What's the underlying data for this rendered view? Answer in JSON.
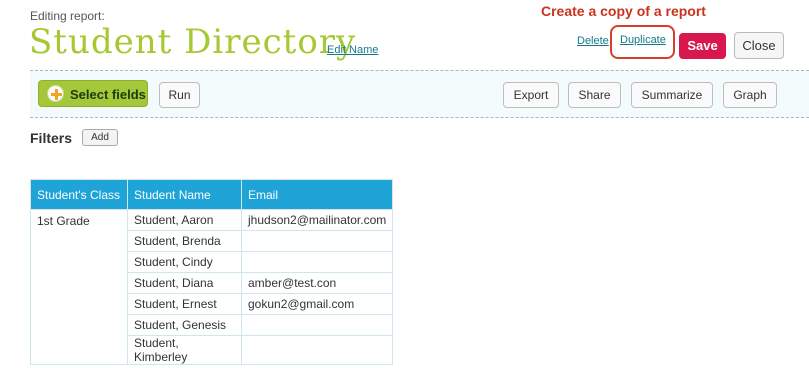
{
  "header": {
    "editing_label": "Editing report:",
    "title": "Student Directory",
    "edit_name": "Edit Name",
    "annotation": "Create a copy of a report",
    "delete_link": "Delete",
    "duplicate_link": "Duplicate",
    "save_button": "Save",
    "close_button": "Close"
  },
  "toolbar": {
    "select_fields": "Select fields",
    "run": "Run",
    "export": "Export",
    "share": "Share",
    "summarize": "Summarize",
    "graph": "Graph"
  },
  "filters": {
    "label": "Filters",
    "add_button": "Add"
  },
  "table": {
    "columns": [
      "Student's Class",
      "Student Name",
      "Email"
    ],
    "class_value": "1st Grade",
    "rows": [
      {
        "name": "Student, Aaron",
        "email": "jhudson2@mailinator.com"
      },
      {
        "name": "Student, Brenda",
        "email": ""
      },
      {
        "name": "Student, Cindy",
        "email": ""
      },
      {
        "name": "Student, Diana",
        "email": "amber@test.con"
      },
      {
        "name": "Student, Ernest",
        "email": "gokun2@gmail.com"
      },
      {
        "name": "Student, Genesis",
        "email": ""
      },
      {
        "name": "Student, Kimberley",
        "email": ""
      }
    ]
  },
  "colors": {
    "title": "#a6c832",
    "save": "#d8174f",
    "table_header": "#1fa4d8",
    "annotation": "#c8331f",
    "link": "#137a8c"
  },
  "icons": {
    "select_fields": "plus-circle-icon"
  }
}
